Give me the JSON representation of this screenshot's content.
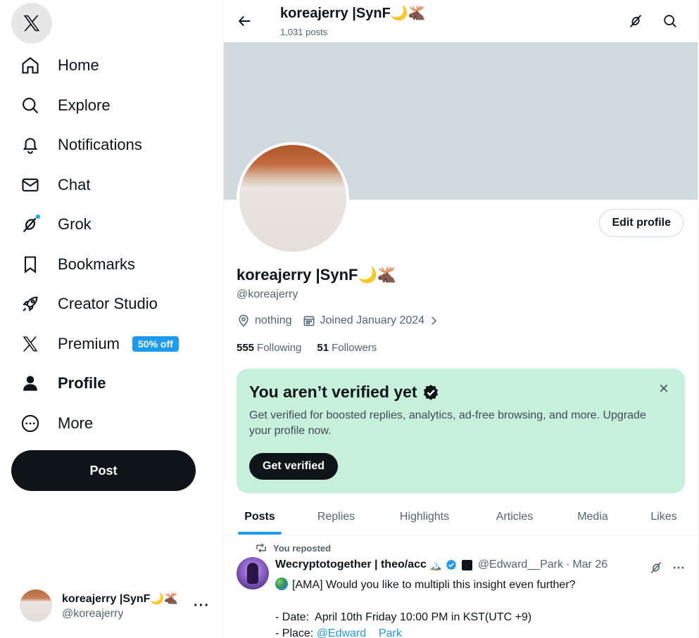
{
  "sidebar": {
    "items": [
      {
        "label": "Home",
        "icon": "home-icon"
      },
      {
        "label": "Explore",
        "icon": "search-icon"
      },
      {
        "label": "Notifications",
        "icon": "bell-icon"
      },
      {
        "label": "Chat",
        "icon": "envelope-icon"
      },
      {
        "label": "Grok",
        "icon": "grok-icon"
      },
      {
        "label": "Bookmarks",
        "icon": "bookmark-icon"
      },
      {
        "label": "Creator Studio",
        "icon": "rocket-icon"
      },
      {
        "label": "Premium",
        "icon": "x-logo-icon",
        "badge": "50% off"
      },
      {
        "label": "Profile",
        "icon": "person-icon"
      },
      {
        "label": "More",
        "icon": "more-circle-icon"
      }
    ],
    "post_label": "Post",
    "account": {
      "name": "koreajerry |SynF🌙🫎",
      "handle": "@koreajerry",
      "more": "···"
    }
  },
  "header": {
    "title": "koreajerry |SynF🌙🫎",
    "posts_count": "1,031 posts"
  },
  "profile": {
    "edit_label": "Edit profile",
    "name": "koreajerry |SynF🌙🫎",
    "handle": "@koreajerry",
    "location": "nothing",
    "joined": "Joined January 2024",
    "following_count": "555",
    "following_label": "Following",
    "followers_count": "51",
    "followers_label": "Followers"
  },
  "verify": {
    "title": "You aren’t verified yet",
    "desc": "Get verified for boosted replies, analytics, ad-free browsing, and more. Upgrade your profile now.",
    "button": "Get verified"
  },
  "tabs": [
    "Posts",
    "Replies",
    "Highlights",
    "Articles",
    "Media",
    "Likes"
  ],
  "post": {
    "repost_label": "You reposted",
    "author": "Wecryptotogether | theo/acc",
    "author_emoji": "🏔️",
    "handle": "@Edward__Park",
    "date": "Mar 26",
    "line1": "[AMA] Would you like to multipli this insight even further?",
    "line2": "- Date:  April 10th Friday 10:00 PM in KST(UTC +9)",
    "line3_prefix": "- Place: ",
    "line3_mention": "@Edward__Park"
  },
  "colors": {
    "accent": "#1d9bf0",
    "banner": "#cfd9de",
    "verify_bg": "#c7f0dc",
    "text": "#0f1419",
    "muted": "#536471"
  }
}
